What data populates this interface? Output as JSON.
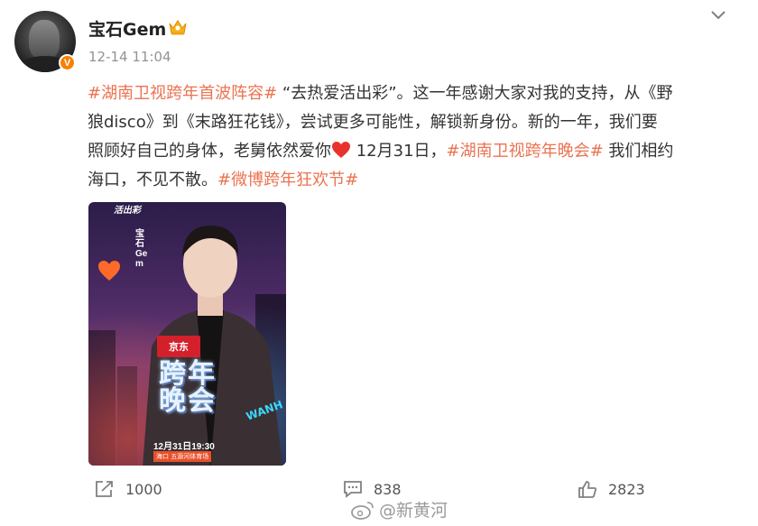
{
  "post": {
    "username": "宝石Gem",
    "timestamp": "12-14 11:04",
    "verified_badge": "V",
    "content": {
      "line1": {
        "tag1": "#湖南卫视跨年首波阵容#",
        "text1": " “去热爱活出彩”。这一年感谢大家对我的支持，从《野"
      },
      "line2": {
        "text": "狼disco》到《末路狂花钱》，尝试更多可能性，解锁新身份。新的一年，我们要"
      },
      "line3": {
        "text1": "照顾好自己的身体，老舅依然爱你",
        "text2": " 12月31日，",
        "tag2": "#湖南卫视跨年晚会#",
        "text3": " 我们相约"
      },
      "line4": {
        "text1": "海口，不见不散。",
        "tag3": "#微博跨年狂欢节#"
      }
    },
    "image": {
      "vertical_text": "宝石Gem",
      "top_logo": "活出彩",
      "sponsor": "京东",
      "show_title": "跨年晚会",
      "side_text": "WANH",
      "date": "12月31日19:30",
      "venue": "海口 五源河体育场"
    }
  },
  "actions": {
    "repost_count": "1000",
    "comment_count": "838",
    "like_count": "2823"
  },
  "watermark": "@新黄河",
  "colors": {
    "tag": "#eb7350",
    "badge": "#f78100",
    "heart": "#e8322e",
    "muted": "#939393"
  },
  "icons": [
    "crown-icon",
    "chevron-down-icon",
    "heart-emoji-icon",
    "repost-icon",
    "comment-icon",
    "like-icon",
    "weibo-logo-icon"
  ]
}
